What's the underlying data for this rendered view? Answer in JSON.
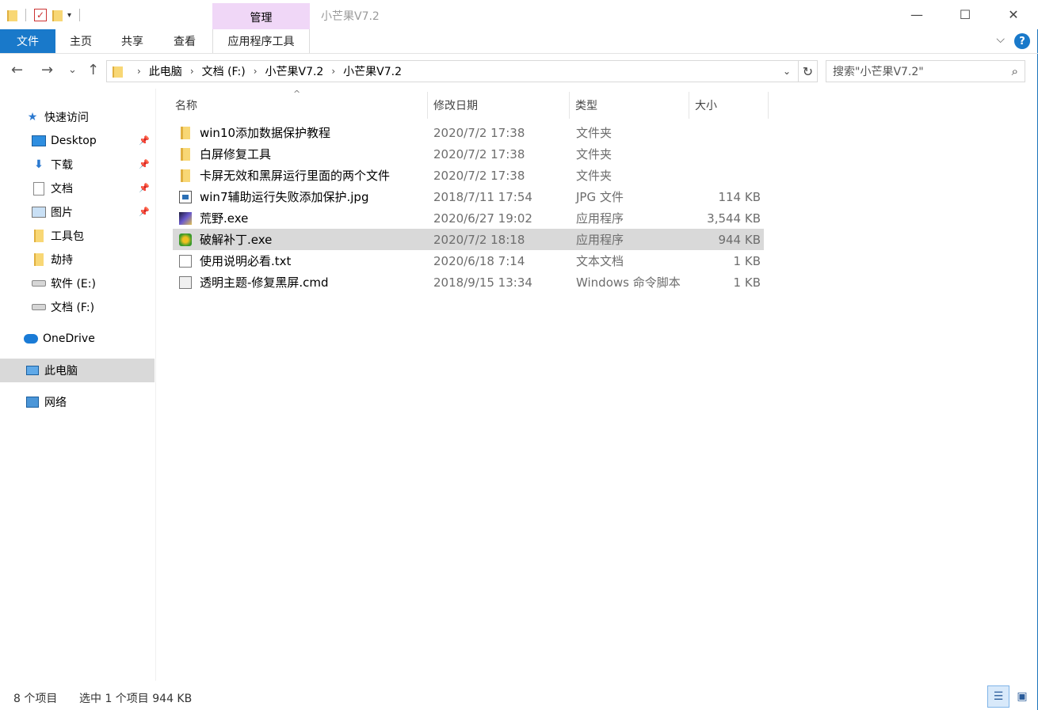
{
  "window": {
    "title": "小芒果V7.2",
    "manage_tab": "管理",
    "minimize": "—",
    "maximize": "☐",
    "close": "✕"
  },
  "ribbon": {
    "tabs": [
      {
        "label": "文件"
      },
      {
        "label": "主页"
      },
      {
        "label": "共享"
      },
      {
        "label": "查看"
      },
      {
        "label": "应用程序工具"
      }
    ],
    "expand": "⌵",
    "help": "?"
  },
  "nav": {
    "back": "←",
    "forward": "→",
    "recent": "⌄",
    "up": "↑",
    "breadcrumb": [
      "此电脑",
      "文档 (F:)",
      "小芒果V7.2",
      "小芒果V7.2"
    ],
    "crumb_sep": "›",
    "dropdown": "⌄",
    "refresh": "↻",
    "search_placeholder": "搜索\"小芒果V7.2\"",
    "search_icon": "⌕"
  },
  "sidebar": {
    "items": [
      {
        "label": "快速访问",
        "icon": "star-icon"
      },
      {
        "label": "Desktop",
        "icon": "desktop-icon"
      },
      {
        "label": "下载",
        "icon": "download-icon"
      },
      {
        "label": "文档",
        "icon": "document-icon"
      },
      {
        "label": "图片",
        "icon": "pictures-icon"
      },
      {
        "label": "工具包",
        "icon": "folder-icon"
      },
      {
        "label": "劫持",
        "icon": "folder-icon"
      },
      {
        "label": "软件 (E:)",
        "icon": "drive-icon"
      },
      {
        "label": "文档 (F:)",
        "icon": "drive-icon"
      },
      {
        "label": "OneDrive",
        "icon": "cloud-icon"
      },
      {
        "label": "此电脑",
        "icon": "computer-icon"
      },
      {
        "label": "网络",
        "icon": "network-icon"
      }
    ],
    "pin": "📌"
  },
  "columns": {
    "name": "名称",
    "date": "修改日期",
    "type": "类型",
    "size": "大小",
    "sort_indicator": "^"
  },
  "files": [
    {
      "name": "win10添加数据保护教程",
      "date": "2020/7/2 17:38",
      "type": "文件夹",
      "size": "",
      "icon": "folder-icon"
    },
    {
      "name": "白屏修复工具",
      "date": "2020/7/2 17:38",
      "type": "文件夹",
      "size": "",
      "icon": "folder-icon"
    },
    {
      "name": "卡屏无效和黑屏运行里面的两个文件",
      "date": "2020/7/2 17:38",
      "type": "文件夹",
      "size": "",
      "icon": "folder-icon"
    },
    {
      "name": "win7辅助运行失败添加保护.jpg",
      "date": "2018/7/11 17:54",
      "type": "JPG 文件",
      "size": "114 KB",
      "icon": "image-file-icon"
    },
    {
      "name": "荒野.exe",
      "date": "2020/6/27 19:02",
      "type": "应用程序",
      "size": "3,544 KB",
      "icon": "application-icon"
    },
    {
      "name": "破解补丁.exe",
      "date": "2020/7/2 18:18",
      "type": "应用程序",
      "size": "944 KB",
      "icon": "application-icon",
      "selected": true
    },
    {
      "name": "使用说明必看.txt",
      "date": "2020/6/18 7:14",
      "type": "文本文档",
      "size": "1 KB",
      "icon": "text-file-icon"
    },
    {
      "name": "透明主题-修复黑屏.cmd",
      "date": "2018/9/15 13:34",
      "type": "Windows 命令脚本",
      "size": "1 KB",
      "icon": "script-file-icon"
    }
  ],
  "status": {
    "count": "8 个项目",
    "selection": "选中 1 个项目  944 KB"
  },
  "colors": {
    "accent": "#1979ca",
    "manage_tab_bg": "#f0d7f7",
    "selection_bg": "#d9d9d9"
  }
}
